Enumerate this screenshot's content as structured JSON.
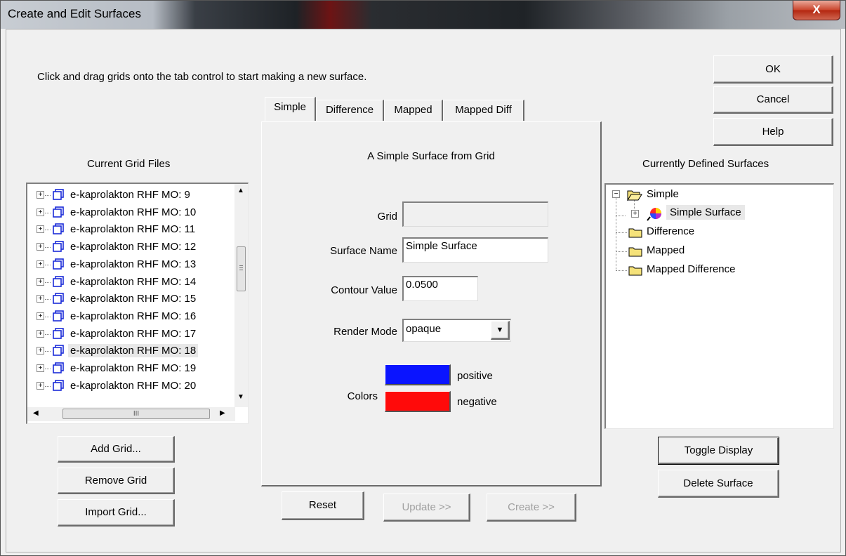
{
  "window": {
    "title": "Create and Edit Surfaces",
    "close_label": "X"
  },
  "instructions": "Click and drag grids onto the tab control to start making a new surface.",
  "dialog_buttons": {
    "ok": "OK",
    "cancel": "Cancel",
    "help": "Help"
  },
  "left_panel": {
    "heading": "Current Grid Files",
    "grids": [
      "e-kaprolakton RHF MO: 9",
      "e-kaprolakton RHF MO: 10",
      "e-kaprolakton RHF MO: 11",
      "e-kaprolakton RHF MO: 12",
      "e-kaprolakton RHF MO: 13",
      "e-kaprolakton RHF MO: 14",
      "e-kaprolakton RHF MO: 15",
      "e-kaprolakton RHF MO: 16",
      "e-kaprolakton RHF MO: 17",
      "e-kaprolakton RHF MO: 18",
      "e-kaprolakton RHF MO: 19",
      "e-kaprolakton RHF MO: 20"
    ],
    "selected_index": 9,
    "hscroll_grip": "III",
    "buttons": {
      "add": "Add Grid...",
      "remove": "Remove Grid",
      "import": "Import Grid..."
    }
  },
  "tabs": [
    "Simple",
    "Difference",
    "Mapped",
    "Mapped Diff"
  ],
  "active_tab": "Simple",
  "simple_tab": {
    "heading": "A Simple Surface from Grid",
    "grid_label": "Grid",
    "grid_value": "",
    "surface_name_label": "Surface Name",
    "surface_name_value": "Simple Surface",
    "contour_label": "Contour Value",
    "contour_value": "0.0500",
    "render_label": "Render Mode",
    "render_value": "opaque",
    "colors_label": "Colors",
    "positive_label": "positive",
    "negative_label": "negative",
    "positive_color": "#0a14ff",
    "negative_color": "#ff0a0a"
  },
  "center_buttons": {
    "reset": "Reset",
    "update": "Update >>",
    "create": "Create >>"
  },
  "right_panel": {
    "heading": "Currently Defined Surfaces",
    "tree": {
      "simple": "Simple",
      "simple_surface": "Simple Surface",
      "difference": "Difference",
      "mapped": "Mapped",
      "mapped_difference": "Mapped Difference"
    },
    "buttons": {
      "toggle": "Toggle Display",
      "delete": "Delete Surface"
    }
  }
}
